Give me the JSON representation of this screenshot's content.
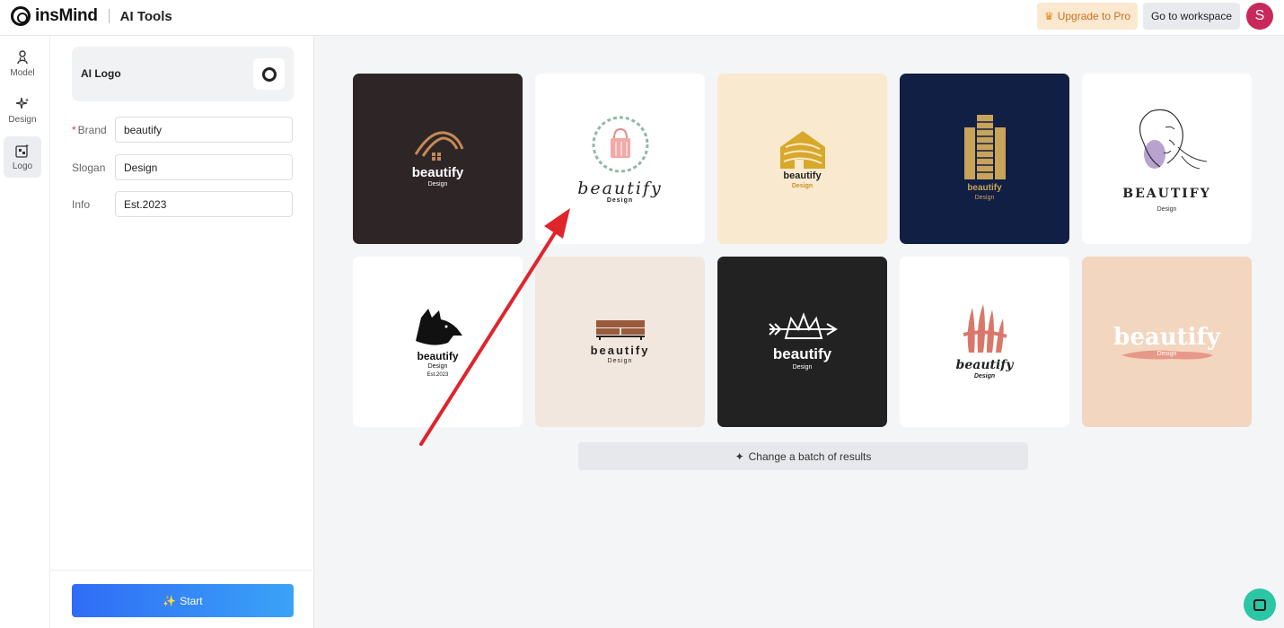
{
  "header": {
    "app_name": "insMind",
    "section": "AI Tools",
    "upgrade_label": "Upgrade to Pro",
    "workspace_label": "Go to workspace",
    "avatar_initial": "S"
  },
  "rail": {
    "items": [
      {
        "label": "Model",
        "icon": "person-icon"
      },
      {
        "label": "Design",
        "icon": "sparkle-icon"
      },
      {
        "label": "Logo",
        "icon": "logo-icon"
      }
    ]
  },
  "panel": {
    "tool_title": "AI Logo",
    "fields": [
      {
        "label": "Brand",
        "required": true,
        "value": "beautify"
      },
      {
        "label": "Slogan",
        "required": false,
        "value": "Design"
      },
      {
        "label": "Info",
        "required": false,
        "value": "Est.2023"
      }
    ],
    "start_label": "Start"
  },
  "results": {
    "cards": [
      {
        "brand": "beautify",
        "slogan": "Design",
        "bg": "#2e2527",
        "fg": "#ffffff",
        "icon": "house-roof-icon"
      },
      {
        "brand": "beautify",
        "slogan": "Design",
        "bg": "#ffffff",
        "fg": "#222222",
        "icon": "shopping-bag-wreath-icon"
      },
      {
        "brand": "beautify",
        "slogan": "Design",
        "bg": "#f9e9cf",
        "fg": "#b8860b",
        "icon": "gold-house-icon"
      },
      {
        "brand": "beautify",
        "slogan": "Design",
        "bg": "#121f44",
        "fg": "#c8a35a",
        "icon": "building-icon"
      },
      {
        "brand": "BEAUTIFY",
        "slogan": "Design",
        "bg": "#ffffff",
        "fg": "#222222",
        "icon": "face-line-art-icon"
      },
      {
        "brand": "beautify",
        "slogan": "Design",
        "info": "Est.2023",
        "bg": "#ffffff",
        "fg": "#111111",
        "icon": "wolf-head-icon"
      },
      {
        "brand": "beautify",
        "slogan": "Design",
        "bg": "#f2e7de",
        "fg": "#222222",
        "icon": "sofa-icon"
      },
      {
        "brand": "beautify",
        "slogan": "Design",
        "bg": "#222222",
        "fg": "#ffffff",
        "icon": "crown-arrow-icon"
      },
      {
        "brand": "beautify",
        "slogan": "Design",
        "bg": "#ffffff",
        "fg": "#222222",
        "icon": "brush-strokes-icon"
      },
      {
        "brand": "beautify",
        "slogan": "Design",
        "bg": "#f3d6bf",
        "fg": "#ffffff",
        "icon": "paint-stroke-icon"
      }
    ],
    "batch_label": "Change a batch of results"
  },
  "colors": {
    "accent_start": "#2f6cf6",
    "accent_end": "#3aa3f6",
    "annotation_arrow": "#e0242c",
    "help": "#2bc6a4"
  }
}
